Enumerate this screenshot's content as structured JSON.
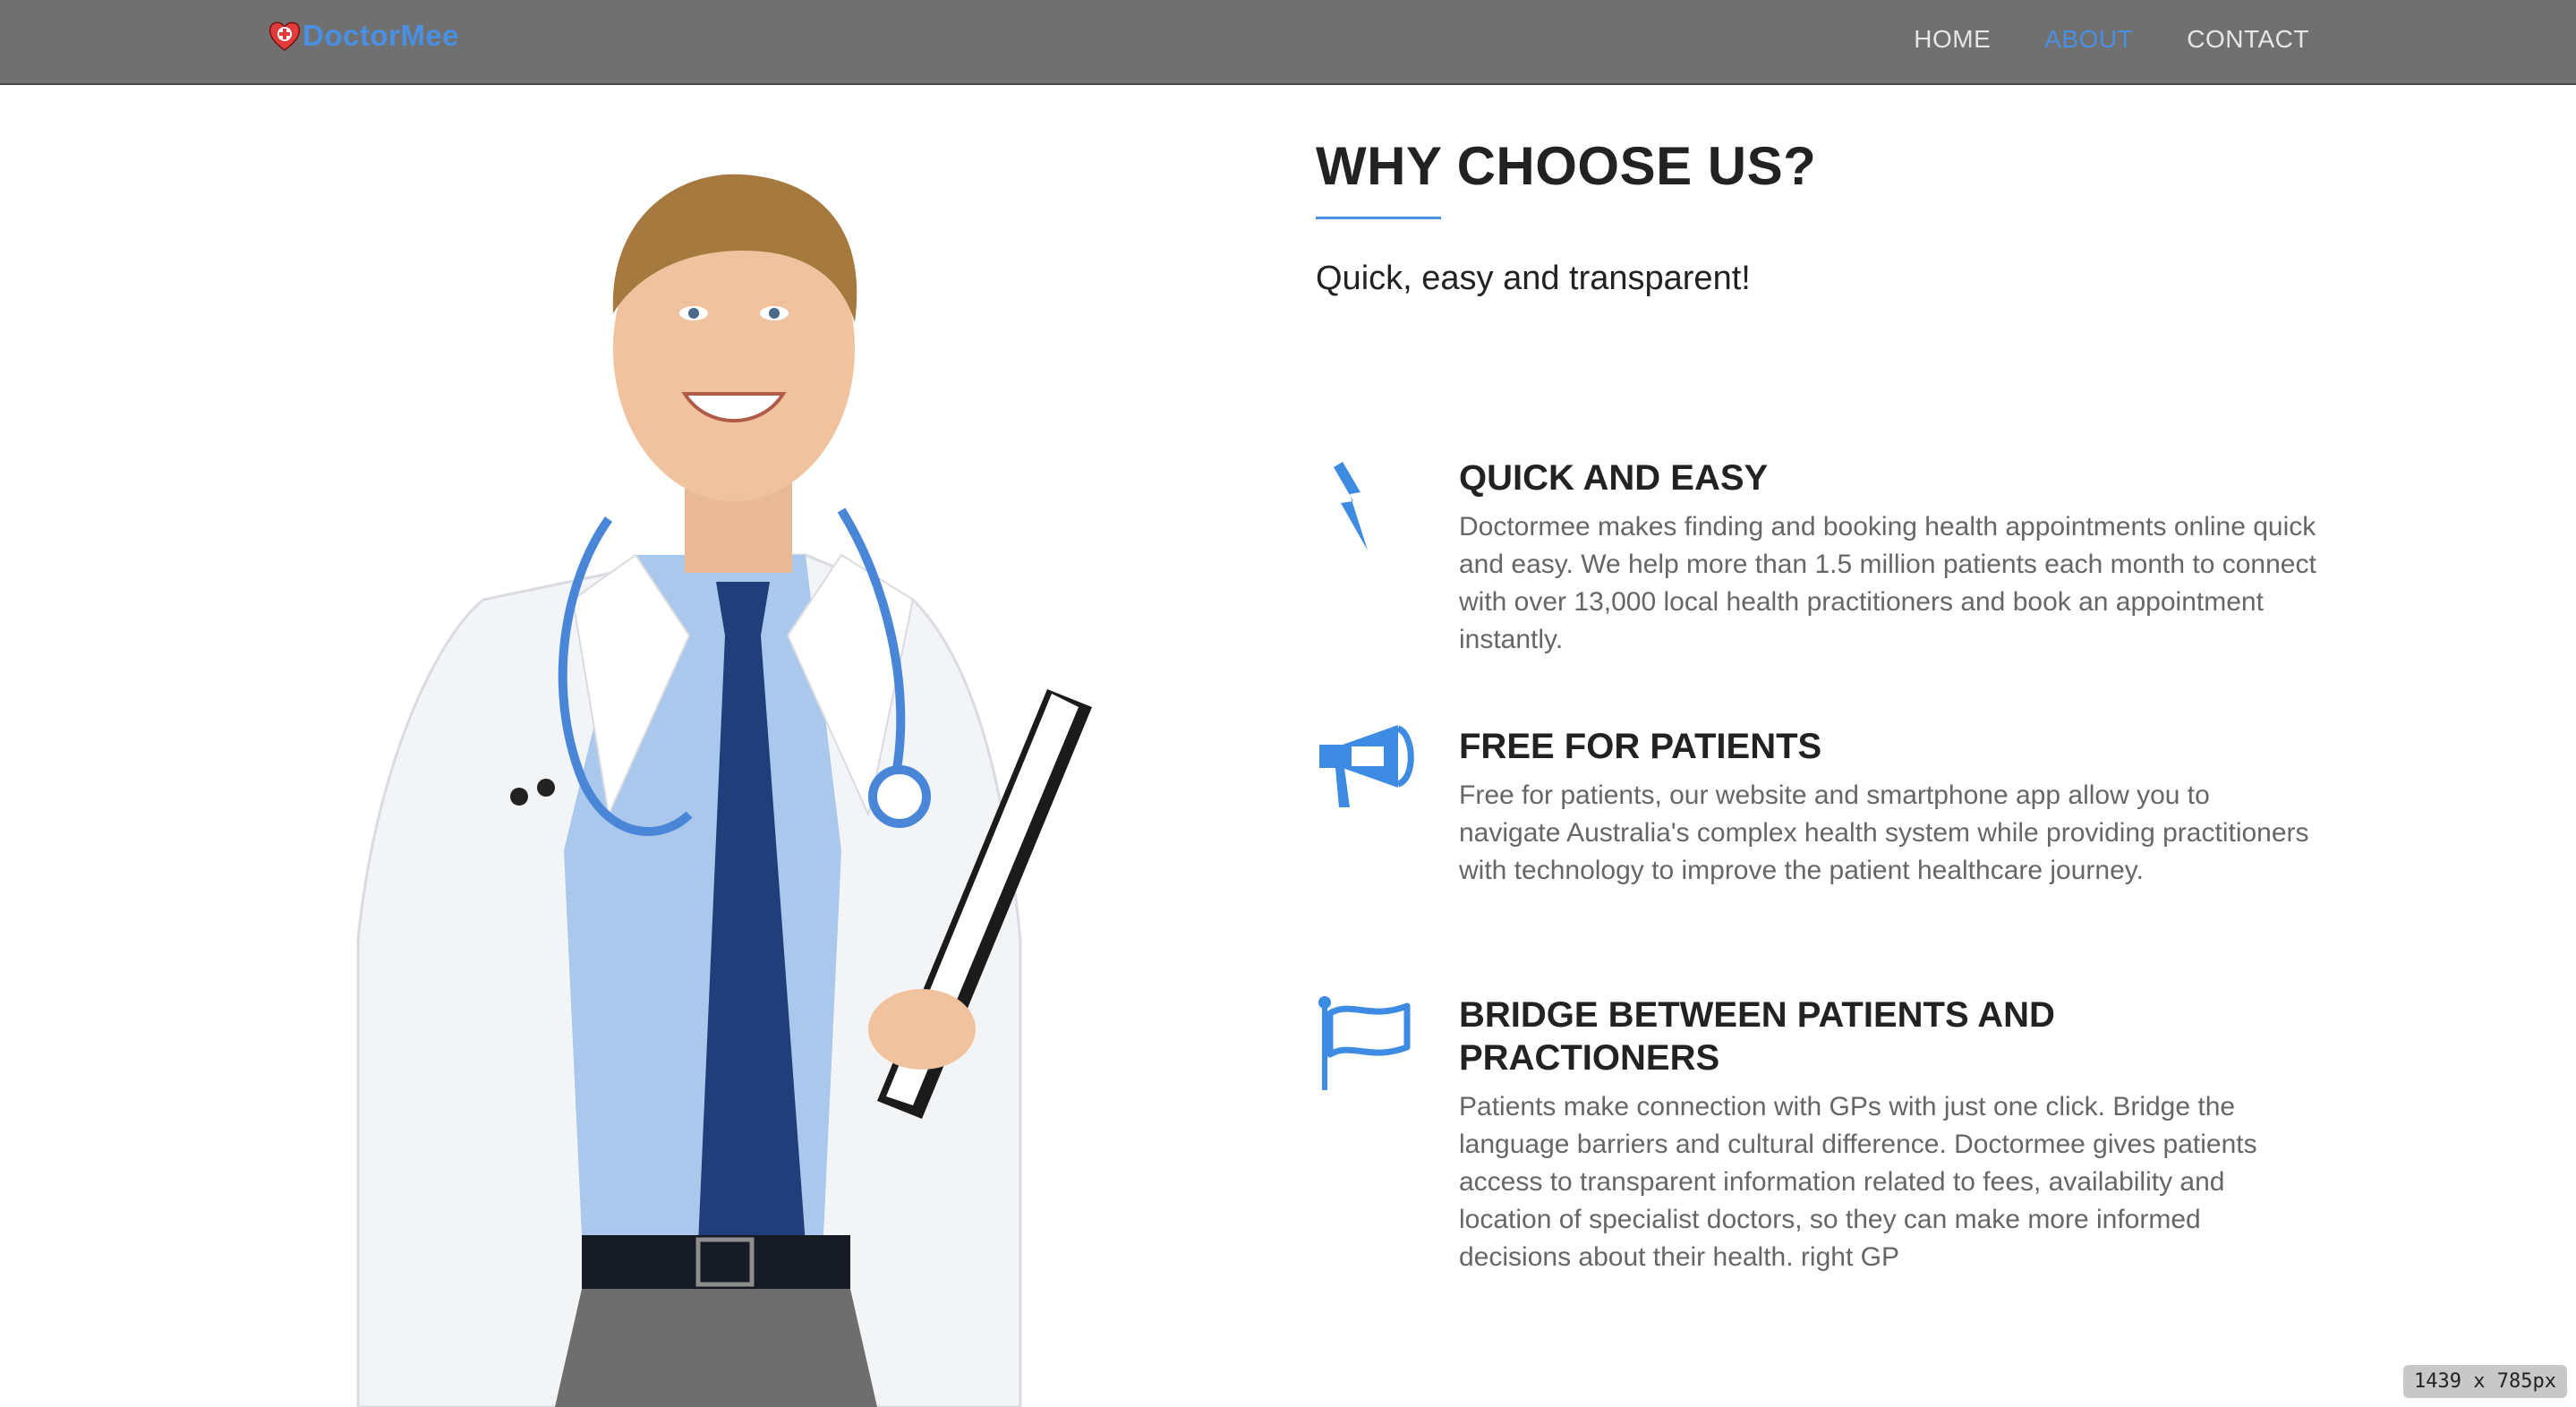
{
  "brand": {
    "name": "DoctorMee",
    "icon": "heart-cross-icon",
    "color": "#4a90e2"
  },
  "nav": {
    "items": [
      {
        "label": "HOME",
        "active": false
      },
      {
        "label": "ABOUT",
        "active": true
      },
      {
        "label": "CONTACT",
        "active": false
      }
    ],
    "active_color": "#4a90e2"
  },
  "hero": {
    "image": "doctor-photo"
  },
  "about": {
    "title": "WHY CHOOSE US?",
    "subtitle": "Quick, easy and transparent!",
    "features": [
      {
        "icon": "lightning-bolt-icon",
        "title": "QUICK AND EASY",
        "text": "Doctormee makes finding and booking health appointments online quick and easy. We help more than 1.5 million patients each month to connect with over 13,000 local health practitioners and book an appointment instantly."
      },
      {
        "icon": "megaphone-icon",
        "title": "FREE FOR PATIENTS",
        "text": "Free for patients, our website and smartphone app allow you to navigate Australia's complex health system while providing practitioners with technology to improve the patient healthcare journey."
      },
      {
        "icon": "flag-icon",
        "title": "BRIDGE BETWEEN PATIENTS AND PRACTIONERS",
        "text": "Patients make connection with GPs with just one click. Bridge the language barriers and cultural difference. Doctormee gives patients access to transparent information related to fees, availability and location of specialist doctors, so they can make more informed decisions about their health. right GP"
      }
    ]
  },
  "viewport_badge": "1439 x 785px"
}
